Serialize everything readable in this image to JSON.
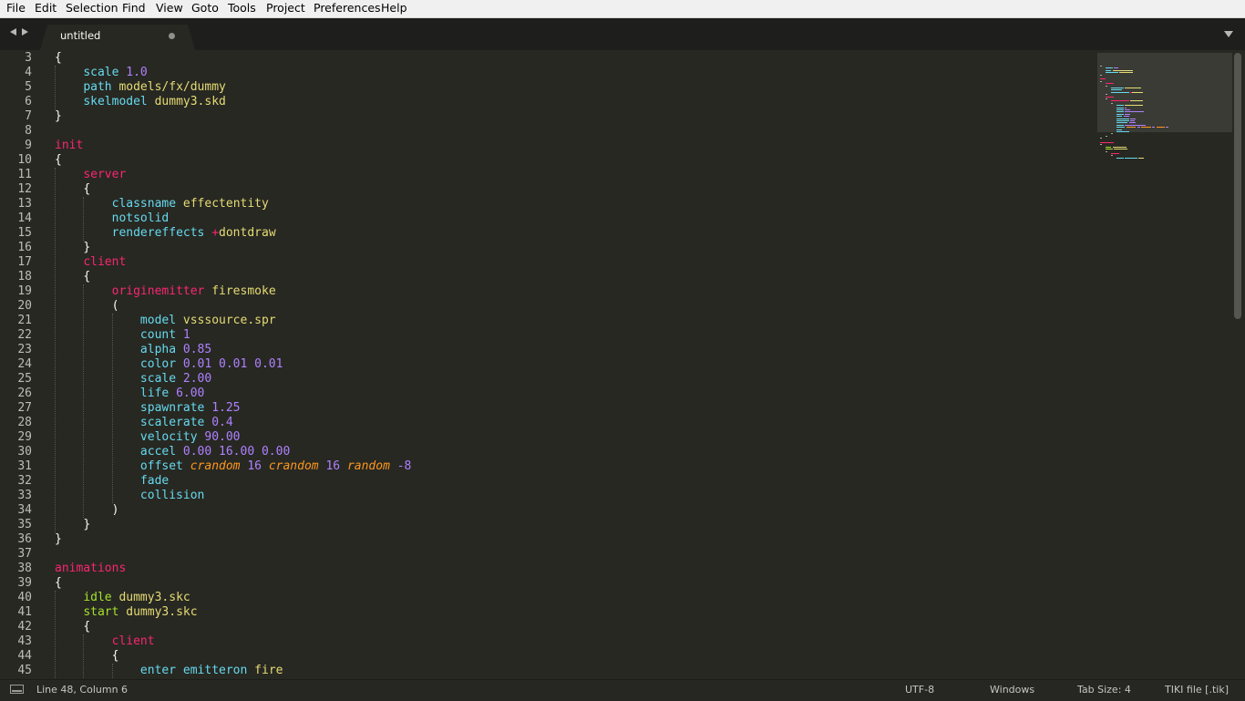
{
  "menubar": {
    "items": [
      "File",
      "Edit",
      "Selection",
      "Find",
      "View",
      "Goto",
      "Tools",
      "Project",
      "Preferences",
      "Help"
    ]
  },
  "tabs": [
    {
      "title": "untitled",
      "dirty": true,
      "active": true
    }
  ],
  "icons": {
    "nav_prev": "triangle-left-icon",
    "nav_next": "triangle-right-icon",
    "tab_dirty": "dot-icon",
    "tab_dropdown": "triangle-down-icon",
    "panel_toggle": "panel-icon"
  },
  "colors": {
    "editor_bg": "#272822",
    "tabbar_bg": "#1e1f1c",
    "keyword_pink": "#f92672",
    "property_cyan": "#66d9ef",
    "string_yellow": "#e6db74",
    "number_purple": "#ae81ff",
    "param_orange": "#fd971f",
    "green": "#a6e22e"
  },
  "editor": {
    "lines": [
      {
        "n": "3",
        "tokens": [
          {
            "t": "{",
            "c": "pl"
          }
        ]
      },
      {
        "n": "4",
        "tokens": [
          {
            "t": "    "
          },
          {
            "t": "scale",
            "c": "cy"
          },
          {
            "t": " "
          },
          {
            "t": "1.0",
            "c": "pu"
          }
        ]
      },
      {
        "n": "5",
        "tokens": [
          {
            "t": "    "
          },
          {
            "t": "path",
            "c": "cy"
          },
          {
            "t": " "
          },
          {
            "t": "models/fx/dummy",
            "c": "ye"
          }
        ]
      },
      {
        "n": "6",
        "tokens": [
          {
            "t": "    "
          },
          {
            "t": "skelmodel",
            "c": "cy"
          },
          {
            "t": " "
          },
          {
            "t": "dummy3.skd",
            "c": "ye"
          }
        ]
      },
      {
        "n": "7",
        "tokens": [
          {
            "t": "}",
            "c": "pl"
          }
        ]
      },
      {
        "n": "8",
        "tokens": []
      },
      {
        "n": "9",
        "tokens": [
          {
            "t": "init",
            "c": "pk"
          }
        ]
      },
      {
        "n": "10",
        "tokens": [
          {
            "t": "{",
            "c": "pl"
          }
        ]
      },
      {
        "n": "11",
        "tokens": [
          {
            "t": "    "
          },
          {
            "t": "server",
            "c": "pk"
          }
        ]
      },
      {
        "n": "12",
        "tokens": [
          {
            "t": "    "
          },
          {
            "t": "{",
            "c": "pl"
          }
        ]
      },
      {
        "n": "13",
        "tokens": [
          {
            "t": "        "
          },
          {
            "t": "classname",
            "c": "cy"
          },
          {
            "t": " "
          },
          {
            "t": "effectentity",
            "c": "ye"
          }
        ]
      },
      {
        "n": "14",
        "tokens": [
          {
            "t": "        "
          },
          {
            "t": "notsolid",
            "c": "cy"
          }
        ]
      },
      {
        "n": "15",
        "tokens": [
          {
            "t": "        "
          },
          {
            "t": "rendereffects",
            "c": "cy"
          },
          {
            "t": " "
          },
          {
            "t": "+",
            "c": "pk"
          },
          {
            "t": "dontdraw",
            "c": "ye"
          }
        ]
      },
      {
        "n": "16",
        "tokens": [
          {
            "t": "    "
          },
          {
            "t": "}",
            "c": "pl"
          }
        ]
      },
      {
        "n": "17",
        "tokens": [
          {
            "t": "    "
          },
          {
            "t": "client",
            "c": "pk"
          }
        ]
      },
      {
        "n": "18",
        "tokens": [
          {
            "t": "    "
          },
          {
            "t": "{",
            "c": "pl"
          }
        ]
      },
      {
        "n": "19",
        "tokens": [
          {
            "t": "        "
          },
          {
            "t": "originemitter",
            "c": "pk"
          },
          {
            "t": " "
          },
          {
            "t": "firesmoke",
            "c": "ye"
          }
        ]
      },
      {
        "n": "20",
        "tokens": [
          {
            "t": "        "
          },
          {
            "t": "(",
            "c": "pl"
          }
        ]
      },
      {
        "n": "21",
        "tokens": [
          {
            "t": "            "
          },
          {
            "t": "model",
            "c": "cy"
          },
          {
            "t": " "
          },
          {
            "t": "vsssource.spr",
            "c": "ye"
          }
        ]
      },
      {
        "n": "22",
        "tokens": [
          {
            "t": "            "
          },
          {
            "t": "count",
            "c": "cy"
          },
          {
            "t": " "
          },
          {
            "t": "1",
            "c": "pu"
          }
        ]
      },
      {
        "n": "23",
        "tokens": [
          {
            "t": "            "
          },
          {
            "t": "alpha",
            "c": "cy"
          },
          {
            "t": " "
          },
          {
            "t": "0.85",
            "c": "pu"
          }
        ]
      },
      {
        "n": "24",
        "tokens": [
          {
            "t": "            "
          },
          {
            "t": "color",
            "c": "cy"
          },
          {
            "t": " "
          },
          {
            "t": "0.01 0.01 0.01",
            "c": "pu"
          }
        ]
      },
      {
        "n": "25",
        "tokens": [
          {
            "t": "            "
          },
          {
            "t": "scale",
            "c": "cy"
          },
          {
            "t": " "
          },
          {
            "t": "2.00",
            "c": "pu"
          }
        ]
      },
      {
        "n": "26",
        "tokens": [
          {
            "t": "            "
          },
          {
            "t": "life",
            "c": "cy"
          },
          {
            "t": " "
          },
          {
            "t": "6.00",
            "c": "pu"
          }
        ]
      },
      {
        "n": "27",
        "tokens": [
          {
            "t": "            "
          },
          {
            "t": "spawnrate",
            "c": "cy"
          },
          {
            "t": " "
          },
          {
            "t": "1.25",
            "c": "pu"
          }
        ]
      },
      {
        "n": "28",
        "tokens": [
          {
            "t": "            "
          },
          {
            "t": "scalerate",
            "c": "cy"
          },
          {
            "t": " "
          },
          {
            "t": "0.4",
            "c": "pu"
          }
        ]
      },
      {
        "n": "29",
        "tokens": [
          {
            "t": "            "
          },
          {
            "t": "velocity",
            "c": "cy"
          },
          {
            "t": " "
          },
          {
            "t": "90.00",
            "c": "pu"
          }
        ]
      },
      {
        "n": "30",
        "tokens": [
          {
            "t": "            "
          },
          {
            "t": "accel",
            "c": "cy"
          },
          {
            "t": " "
          },
          {
            "t": "0.00 16.00 0.00",
            "c": "pu"
          }
        ]
      },
      {
        "n": "31",
        "tokens": [
          {
            "t": "            "
          },
          {
            "t": "offset",
            "c": "cy"
          },
          {
            "t": " "
          },
          {
            "t": "crandom",
            "c": "or"
          },
          {
            "t": " "
          },
          {
            "t": "16",
            "c": "pu"
          },
          {
            "t": " "
          },
          {
            "t": "crandom",
            "c": "or"
          },
          {
            "t": " "
          },
          {
            "t": "16",
            "c": "pu"
          },
          {
            "t": " "
          },
          {
            "t": "random",
            "c": "or"
          },
          {
            "t": " "
          },
          {
            "t": "-8",
            "c": "pu"
          }
        ]
      },
      {
        "n": "32",
        "tokens": [
          {
            "t": "            "
          },
          {
            "t": "fade",
            "c": "cy"
          }
        ]
      },
      {
        "n": "33",
        "tokens": [
          {
            "t": "            "
          },
          {
            "t": "collision",
            "c": "cy"
          }
        ]
      },
      {
        "n": "34",
        "tokens": [
          {
            "t": "        "
          },
          {
            "t": ")",
            "c": "pl"
          }
        ]
      },
      {
        "n": "35",
        "tokens": [
          {
            "t": "    "
          },
          {
            "t": "}",
            "c": "pl"
          }
        ]
      },
      {
        "n": "36",
        "tokens": [
          {
            "t": "}",
            "c": "pl"
          }
        ]
      },
      {
        "n": "37",
        "tokens": []
      },
      {
        "n": "38",
        "tokens": [
          {
            "t": "animations",
            "c": "pk"
          }
        ]
      },
      {
        "n": "39",
        "tokens": [
          {
            "t": "{",
            "c": "pl"
          }
        ]
      },
      {
        "n": "40",
        "tokens": [
          {
            "t": "    "
          },
          {
            "t": "idle",
            "c": "gr"
          },
          {
            "t": " "
          },
          {
            "t": "dummy3.skc",
            "c": "ye"
          }
        ]
      },
      {
        "n": "41",
        "tokens": [
          {
            "t": "    "
          },
          {
            "t": "start",
            "c": "gr"
          },
          {
            "t": " "
          },
          {
            "t": "dummy3.skc",
            "c": "ye"
          }
        ]
      },
      {
        "n": "42",
        "tokens": [
          {
            "t": "    "
          },
          {
            "t": "{",
            "c": "pl"
          }
        ]
      },
      {
        "n": "43",
        "tokens": [
          {
            "t": "        "
          },
          {
            "t": "client",
            "c": "pk"
          }
        ]
      },
      {
        "n": "44",
        "tokens": [
          {
            "t": "        "
          },
          {
            "t": "{",
            "c": "pl"
          }
        ]
      },
      {
        "n": "45",
        "tokens": [
          {
            "t": "            "
          },
          {
            "t": "enter",
            "c": "cy"
          },
          {
            "t": " "
          },
          {
            "t": "emitteron",
            "c": "cy"
          },
          {
            "t": " "
          },
          {
            "t": "fire",
            "c": "ye"
          }
        ]
      }
    ]
  },
  "statusbar": {
    "position": "Line 48, Column 6",
    "encoding": "UTF-8",
    "line_endings": "Windows",
    "tab_size": "Tab Size: 4",
    "syntax": "TIKI file [.tik]"
  }
}
